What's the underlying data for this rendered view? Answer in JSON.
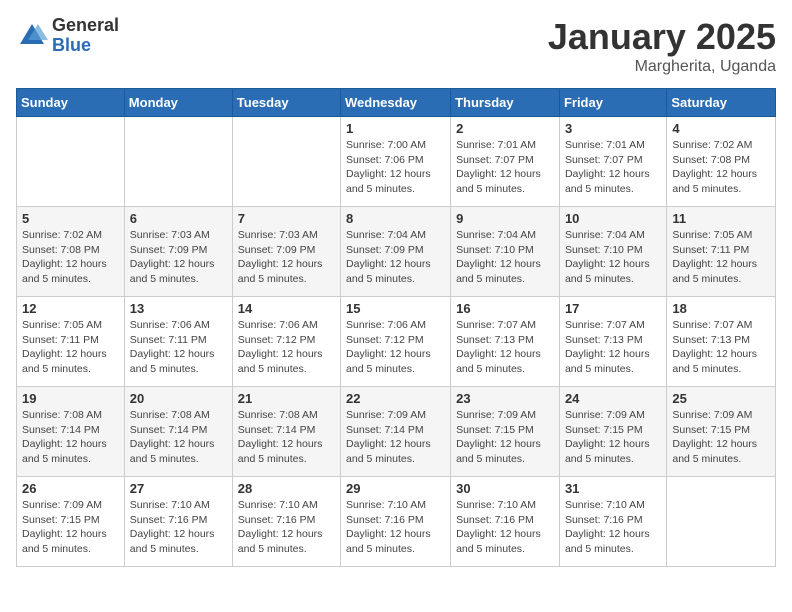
{
  "logo": {
    "general": "General",
    "blue": "Blue"
  },
  "header": {
    "title": "January 2025",
    "location": "Margherita, Uganda"
  },
  "weekdays": [
    "Sunday",
    "Monday",
    "Tuesday",
    "Wednesday",
    "Thursday",
    "Friday",
    "Saturday"
  ],
  "weeks": [
    [
      {
        "day": "",
        "info": ""
      },
      {
        "day": "",
        "info": ""
      },
      {
        "day": "",
        "info": ""
      },
      {
        "day": "1",
        "info": "Sunrise: 7:00 AM\nSunset: 7:06 PM\nDaylight: 12 hours\nand 5 minutes."
      },
      {
        "day": "2",
        "info": "Sunrise: 7:01 AM\nSunset: 7:07 PM\nDaylight: 12 hours\nand 5 minutes."
      },
      {
        "day": "3",
        "info": "Sunrise: 7:01 AM\nSunset: 7:07 PM\nDaylight: 12 hours\nand 5 minutes."
      },
      {
        "day": "4",
        "info": "Sunrise: 7:02 AM\nSunset: 7:08 PM\nDaylight: 12 hours\nand 5 minutes."
      }
    ],
    [
      {
        "day": "5",
        "info": "Sunrise: 7:02 AM\nSunset: 7:08 PM\nDaylight: 12 hours\nand 5 minutes."
      },
      {
        "day": "6",
        "info": "Sunrise: 7:03 AM\nSunset: 7:09 PM\nDaylight: 12 hours\nand 5 minutes."
      },
      {
        "day": "7",
        "info": "Sunrise: 7:03 AM\nSunset: 7:09 PM\nDaylight: 12 hours\nand 5 minutes."
      },
      {
        "day": "8",
        "info": "Sunrise: 7:04 AM\nSunset: 7:09 PM\nDaylight: 12 hours\nand 5 minutes."
      },
      {
        "day": "9",
        "info": "Sunrise: 7:04 AM\nSunset: 7:10 PM\nDaylight: 12 hours\nand 5 minutes."
      },
      {
        "day": "10",
        "info": "Sunrise: 7:04 AM\nSunset: 7:10 PM\nDaylight: 12 hours\nand 5 minutes."
      },
      {
        "day": "11",
        "info": "Sunrise: 7:05 AM\nSunset: 7:11 PM\nDaylight: 12 hours\nand 5 minutes."
      }
    ],
    [
      {
        "day": "12",
        "info": "Sunrise: 7:05 AM\nSunset: 7:11 PM\nDaylight: 12 hours\nand 5 minutes."
      },
      {
        "day": "13",
        "info": "Sunrise: 7:06 AM\nSunset: 7:11 PM\nDaylight: 12 hours\nand 5 minutes."
      },
      {
        "day": "14",
        "info": "Sunrise: 7:06 AM\nSunset: 7:12 PM\nDaylight: 12 hours\nand 5 minutes."
      },
      {
        "day": "15",
        "info": "Sunrise: 7:06 AM\nSunset: 7:12 PM\nDaylight: 12 hours\nand 5 minutes."
      },
      {
        "day": "16",
        "info": "Sunrise: 7:07 AM\nSunset: 7:13 PM\nDaylight: 12 hours\nand 5 minutes."
      },
      {
        "day": "17",
        "info": "Sunrise: 7:07 AM\nSunset: 7:13 PM\nDaylight: 12 hours\nand 5 minutes."
      },
      {
        "day": "18",
        "info": "Sunrise: 7:07 AM\nSunset: 7:13 PM\nDaylight: 12 hours\nand 5 minutes."
      }
    ],
    [
      {
        "day": "19",
        "info": "Sunrise: 7:08 AM\nSunset: 7:14 PM\nDaylight: 12 hours\nand 5 minutes."
      },
      {
        "day": "20",
        "info": "Sunrise: 7:08 AM\nSunset: 7:14 PM\nDaylight: 12 hours\nand 5 minutes."
      },
      {
        "day": "21",
        "info": "Sunrise: 7:08 AM\nSunset: 7:14 PM\nDaylight: 12 hours\nand 5 minutes."
      },
      {
        "day": "22",
        "info": "Sunrise: 7:09 AM\nSunset: 7:14 PM\nDaylight: 12 hours\nand 5 minutes."
      },
      {
        "day": "23",
        "info": "Sunrise: 7:09 AM\nSunset: 7:15 PM\nDaylight: 12 hours\nand 5 minutes."
      },
      {
        "day": "24",
        "info": "Sunrise: 7:09 AM\nSunset: 7:15 PM\nDaylight: 12 hours\nand 5 minutes."
      },
      {
        "day": "25",
        "info": "Sunrise: 7:09 AM\nSunset: 7:15 PM\nDaylight: 12 hours\nand 5 minutes."
      }
    ],
    [
      {
        "day": "26",
        "info": "Sunrise: 7:09 AM\nSunset: 7:15 PM\nDaylight: 12 hours\nand 5 minutes."
      },
      {
        "day": "27",
        "info": "Sunrise: 7:10 AM\nSunset: 7:16 PM\nDaylight: 12 hours\nand 5 minutes."
      },
      {
        "day": "28",
        "info": "Sunrise: 7:10 AM\nSunset: 7:16 PM\nDaylight: 12 hours\nand 5 minutes."
      },
      {
        "day": "29",
        "info": "Sunrise: 7:10 AM\nSunset: 7:16 PM\nDaylight: 12 hours\nand 5 minutes."
      },
      {
        "day": "30",
        "info": "Sunrise: 7:10 AM\nSunset: 7:16 PM\nDaylight: 12 hours\nand 5 minutes."
      },
      {
        "day": "31",
        "info": "Sunrise: 7:10 AM\nSunset: 7:16 PM\nDaylight: 12 hours\nand 5 minutes."
      },
      {
        "day": "",
        "info": ""
      }
    ]
  ]
}
